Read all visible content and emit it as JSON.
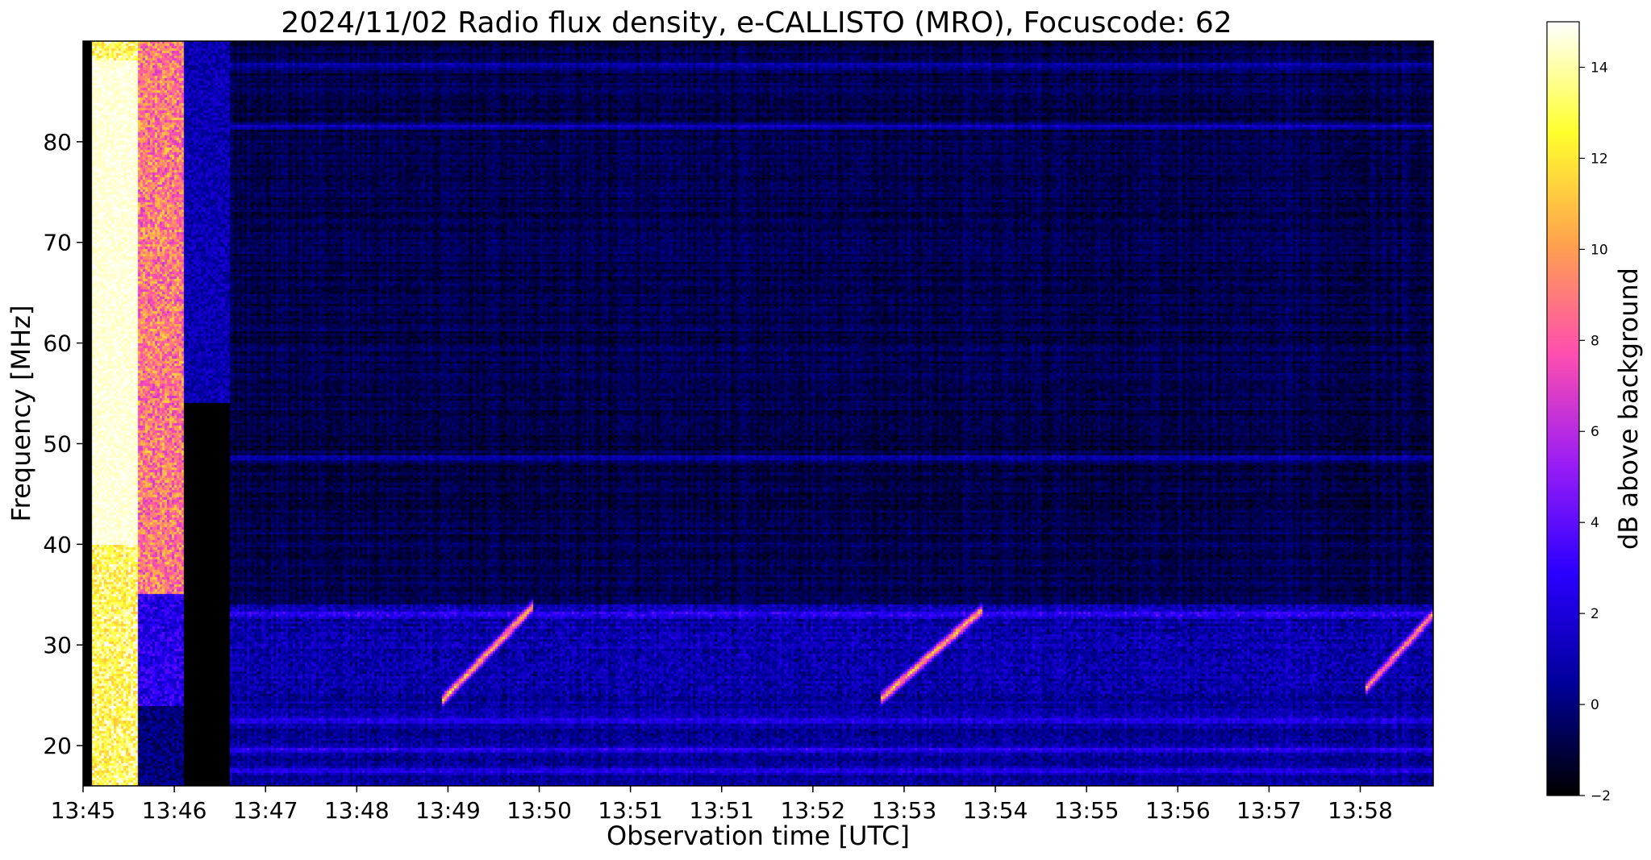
{
  "chart_data": {
    "type": "heatmap",
    "title": "2024/11/02  Radio flux density, e-CALLISTO (MRO), Focuscode: 62",
    "xlabel": "Observation time [UTC]",
    "ylabel": "Frequency [MHz]",
    "colorbar_label": "dB above background",
    "colormap": "gnuplot2",
    "colormap_stops": [
      "#000000",
      "#00009a",
      "#2a00ff",
      "#9b1df6",
      "#ff4fb0",
      "#ffa34e",
      "#ffff2e",
      "#ffffff"
    ],
    "x_tick_labels": [
      "13:45",
      "13:46",
      "13:47",
      "13:48",
      "13:49",
      "13:50",
      "13:51",
      "13:51",
      "13:52",
      "13:53",
      "13:54",
      "13:55",
      "13:56",
      "13:57",
      "13:58"
    ],
    "xlim_minutes": [
      0,
      14.8
    ],
    "ylim": [
      16,
      90
    ],
    "y_ticks": [
      20,
      30,
      40,
      50,
      60,
      70,
      80
    ],
    "color_range": [
      -2,
      15
    ],
    "colorbar_ticks": [
      -2,
      0,
      2,
      4,
      6,
      8,
      10,
      12,
      14
    ],
    "grid": false,
    "features": {
      "saturated_start_columns": [
        {
          "t_start": 0.1,
          "t_end": 0.6,
          "level_db": 15
        },
        {
          "t_start": 0.6,
          "t_end": 1.1,
          "level_db": 9
        },
        {
          "t_start": 1.1,
          "t_end": 1.6,
          "level_db": 1
        }
      ],
      "background_db": -0.8,
      "bright_band_low": {
        "f_low": 25,
        "f_high": 34,
        "level_db": 2
      },
      "horizontal_lines_mhz": [
        48.5,
        19.5,
        17.5,
        22.5,
        33,
        81.5,
        87.5
      ],
      "type_iii_drifts": [
        {
          "t_start": 4.0,
          "t_end": 4.9,
          "f_start": 25,
          "f_end": 33.5,
          "peak_db": 13
        },
        {
          "t_start": 8.8,
          "t_end": 9.8,
          "f_start": 25,
          "f_end": 33,
          "peak_db": 13
        },
        {
          "t_start": 14.1,
          "t_end": 14.8,
          "f_start": 26,
          "f_end": 33,
          "peak_db": 12
        }
      ]
    }
  }
}
